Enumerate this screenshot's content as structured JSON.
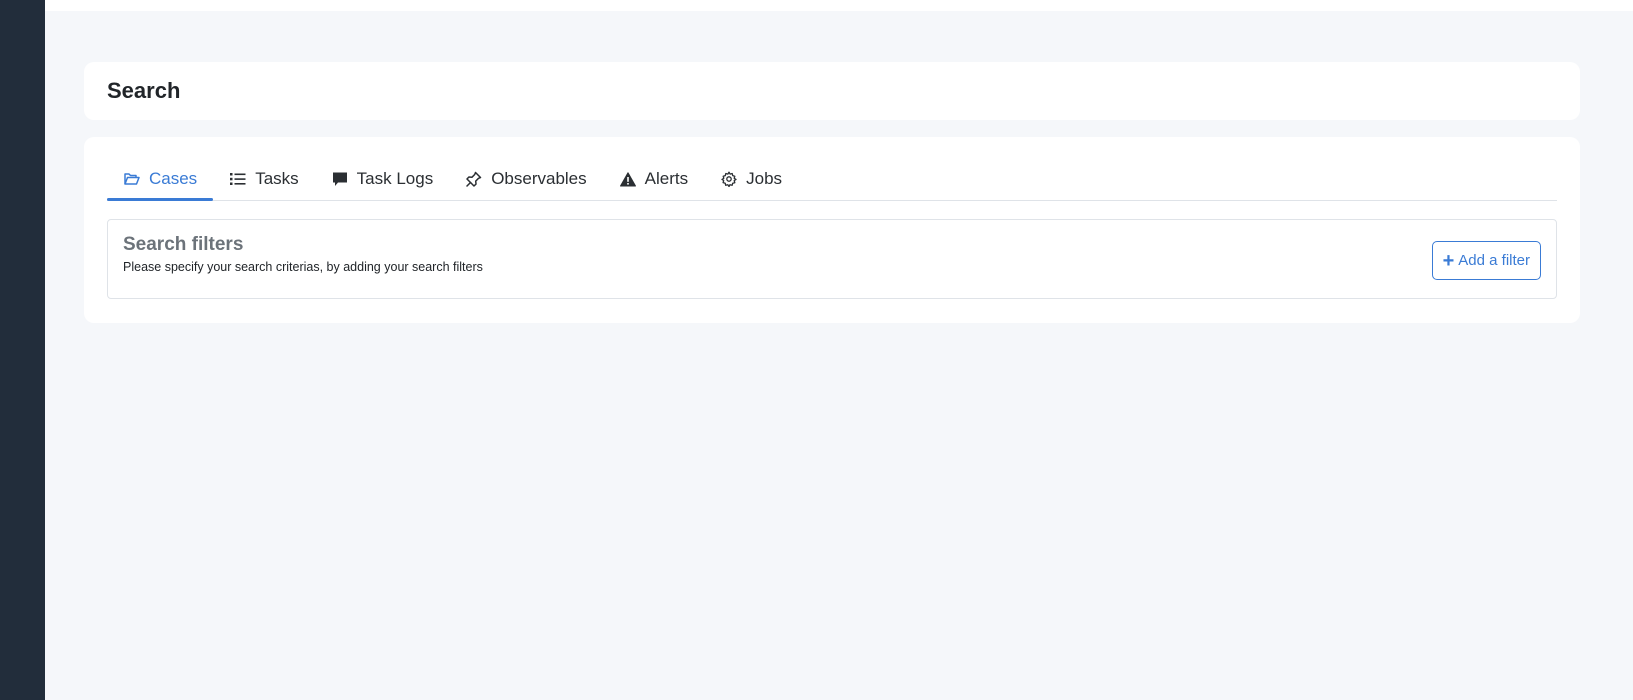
{
  "page": {
    "title": "Search"
  },
  "tabs": [
    {
      "label": "Cases",
      "icon": "folder-open-icon",
      "active": true
    },
    {
      "label": "Tasks",
      "icon": "list-icon"
    },
    {
      "label": "Task Logs",
      "icon": "comment-icon"
    },
    {
      "label": "Observables",
      "icon": "pin-icon"
    },
    {
      "label": "Alerts",
      "icon": "warning-icon"
    },
    {
      "label": "Jobs",
      "icon": "gear-icon"
    }
  ],
  "filters": {
    "title": "Search filters",
    "description": "Please specify your search criterias, by adding your search filters",
    "add_button_label": "Add a filter"
  },
  "colors": {
    "sidebar": "#222d3b",
    "accent": "#3a7bd5",
    "background": "#f5f7fa"
  }
}
